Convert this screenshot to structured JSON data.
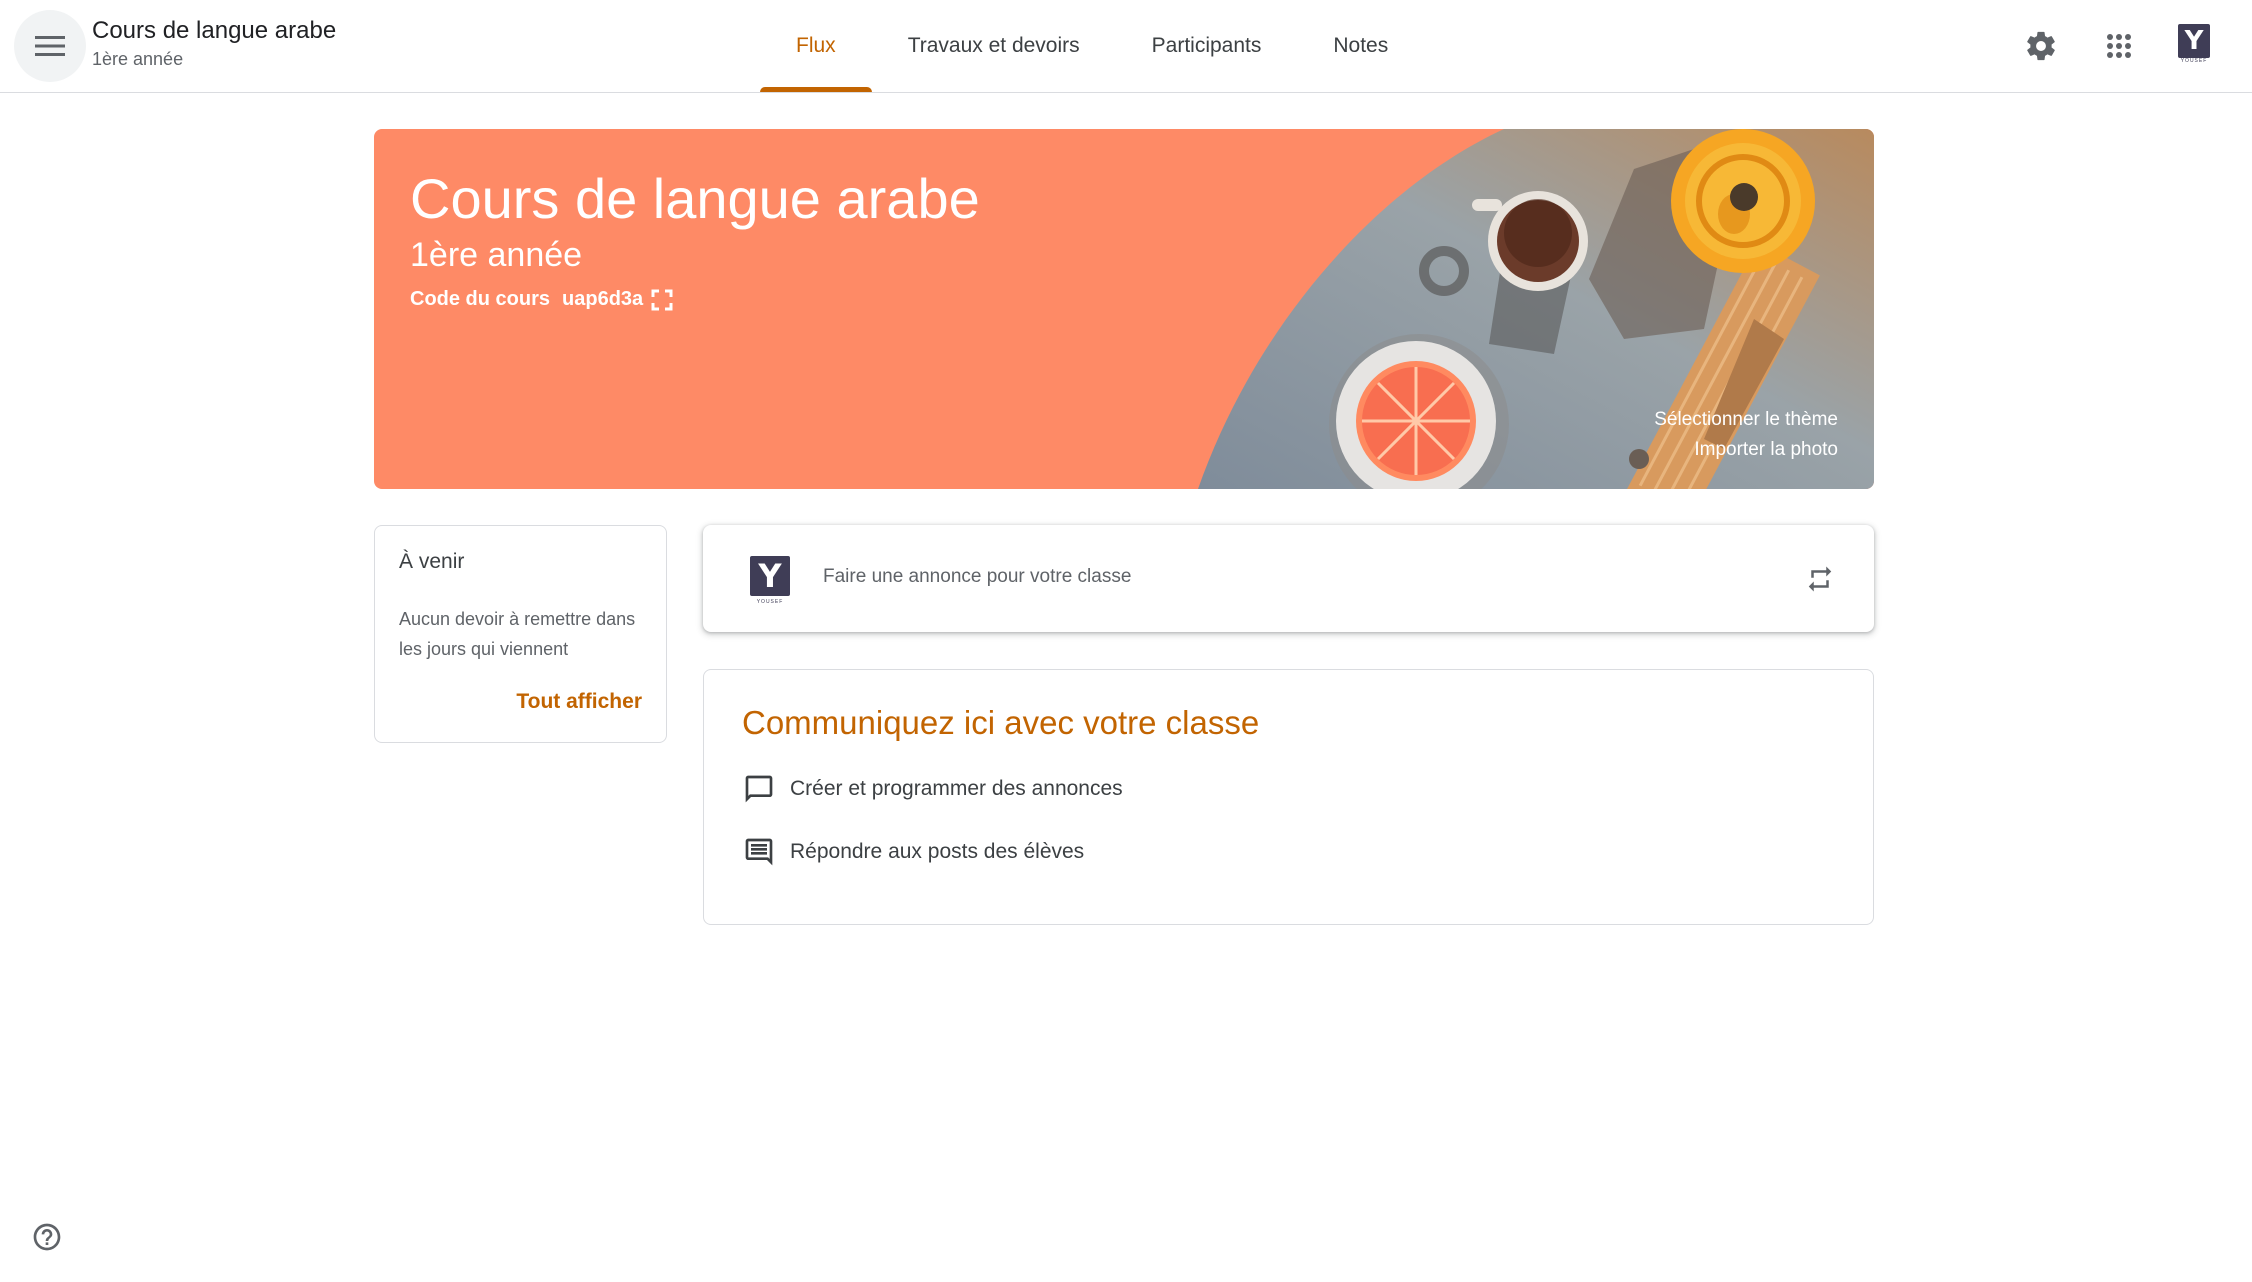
{
  "header": {
    "title": "Cours de langue arabe",
    "subtitle": "1ère année",
    "tabs": [
      {
        "label": "Flux",
        "active": true
      },
      {
        "label": "Travaux et devoirs",
        "active": false
      },
      {
        "label": "Participants",
        "active": false
      },
      {
        "label": "Notes",
        "active": false
      }
    ],
    "icons": [
      "menu-icon",
      "gear-icon",
      "apps-grid-icon"
    ],
    "avatar_letter": "Y",
    "avatar_caption": "YOUSEF"
  },
  "banner": {
    "title": "Cours de langue arabe",
    "subtitle": "1ère année",
    "code_label": "Code du cours",
    "code_value": "uap6d3a",
    "select_theme": "Sélectionner le thème",
    "import_photo": "Importer la photo",
    "color": "#fe8a66"
  },
  "upcoming": {
    "title": "À venir",
    "text": "Aucun devoir à remettre dans les jours qui viennent",
    "link": "Tout afficher"
  },
  "announce": {
    "avatar_letter": "Y",
    "avatar_caption": "YOUSEF",
    "placeholder": "Faire une annonce pour votre classe"
  },
  "communicate": {
    "title": "Communiquez ici avec votre classe",
    "items": [
      {
        "label": "Créer et programmer des annonces",
        "icon": "chat-bubble-icon"
      },
      {
        "label": "Répondre aux posts des élèves",
        "icon": "comment-lines-icon"
      }
    ]
  },
  "colors": {
    "accent": "#c26401",
    "border": "#dadce0",
    "text": "#3c4043",
    "avatar_bg": "#3f3d56"
  }
}
